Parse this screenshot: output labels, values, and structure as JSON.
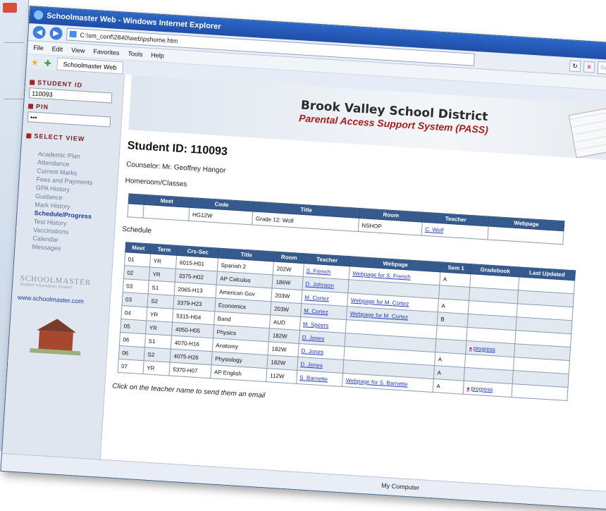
{
  "window": {
    "title": "Schoolmaster Web - Windows Internet Explorer",
    "address": "C:\\sm_conf\\2840\\web\\pshome.htm",
    "search_placeholder": "Google",
    "menu": [
      "File",
      "Edit",
      "View",
      "Favorites",
      "Tools",
      "Help"
    ],
    "tab_label": "Schoolmaster Web",
    "status_zone": "My Computer"
  },
  "sidebar": {
    "student_id_label": "Student ID",
    "student_id_value": "110093",
    "pin_label": "PIN",
    "pin_value": "•••",
    "select_view_label": "Select View",
    "views": [
      "Academic Plan",
      "Attendance",
      "Current Marks",
      "Fees and Payments",
      "GPA History",
      "Guidance",
      "Mark History",
      "Schedule/Progress",
      "Test History",
      "Vaccinations",
      "Calendar",
      "Messages"
    ],
    "selected_view": "Schedule/Progress",
    "brand": "SCHOOLMASTER",
    "brand_sub": "Student Information System",
    "brand_url": "www.schoolmaster.com"
  },
  "banner": {
    "district": "Brook Valley School District",
    "system": "Parental Access Support System (PASS)"
  },
  "student": {
    "heading": "Student ID: 110093",
    "counselor": "Counselor: Mr. Geoffrey Hangor",
    "homeroom_label": "Homeroom/Classes",
    "schedule_label": "Schedule"
  },
  "homeroom_table": {
    "headers": [
      "",
      "Meet",
      "Code",
      "Title",
      "Room",
      "Teacher",
      "Webpage"
    ],
    "rows": [
      [
        "",
        "",
        "HG12W",
        "Grade 12: Wolf",
        "NSHOP",
        "C. Wolf",
        ""
      ]
    ]
  },
  "schedule_table": {
    "headers": [
      "Meet",
      "Term",
      "Crs-Sec",
      "Title",
      "Room",
      "Teacher",
      "Webpage",
      "Sem 1",
      "Gradebook",
      "Last Updated"
    ],
    "rows": [
      [
        "01",
        "YR",
        "6015-H01",
        "Spanish 2",
        "202W",
        "S. French",
        "Webpage for S. French",
        "A",
        "",
        ""
      ],
      [
        "02",
        "YR",
        "3375-H02",
        "AP Calculus",
        "186W",
        "D. Johnson",
        "",
        "",
        "",
        ""
      ],
      [
        "03",
        "S1",
        "2065-H13",
        "American Gov",
        "203W",
        "M. Cortez",
        "Webpage for M. Cortez",
        "A",
        "",
        ""
      ],
      [
        "03",
        "S2",
        "3379-H23",
        "Economics",
        "203W",
        "M. Cortez",
        "Webpage for M. Cortez",
        "B",
        "",
        ""
      ],
      [
        "04",
        "YR",
        "5315-H04",
        "Band",
        "AUD",
        "M. Speers",
        "",
        "",
        "",
        ""
      ],
      [
        "05",
        "YR",
        "4050-H05",
        "Physics",
        "182W",
        "D. Jones",
        "",
        "",
        "progress",
        ""
      ],
      [
        "06",
        "S1",
        "4070-H16",
        "Anatomy",
        "182W",
        "D. Jones",
        "",
        "A",
        "",
        ""
      ],
      [
        "06",
        "S2",
        "4075-H26",
        "Physiology",
        "182W",
        "D. Jones",
        "",
        "A",
        "",
        ""
      ],
      [
        "07",
        "YR",
        "5370-H07",
        "AP English",
        "112W",
        "S. Barnette",
        "Webpage for S. Barnette",
        "A",
        "progress",
        ""
      ]
    ]
  },
  "hint": "Click on the teacher name to send them an email"
}
